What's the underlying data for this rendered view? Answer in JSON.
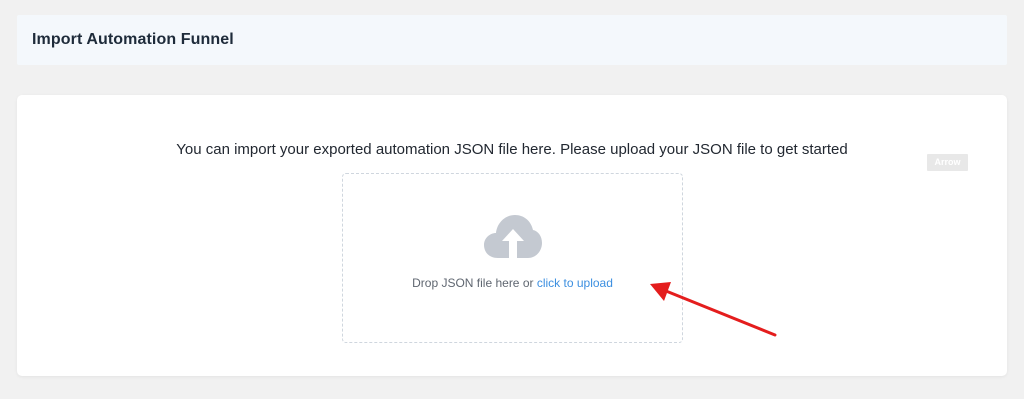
{
  "header": {
    "title": "Import Automation Funnel"
  },
  "import_card": {
    "prompt": "You can import your exported automation JSON file here. Please upload your JSON file to get started",
    "dropzone": {
      "text": "Drop JSON file here or",
      "link_label": "click to upload",
      "icon": "cloud-upload-icon"
    }
  },
  "annotation": {
    "label": "Arrow",
    "color": "#e41d1d",
    "icon": "arrow-icon"
  },
  "colors": {
    "page_background": "#f1f1f1",
    "header_background": "#f4f8fc",
    "link": "#3c8fe0",
    "cloud_icon": "#c4c9d1"
  }
}
